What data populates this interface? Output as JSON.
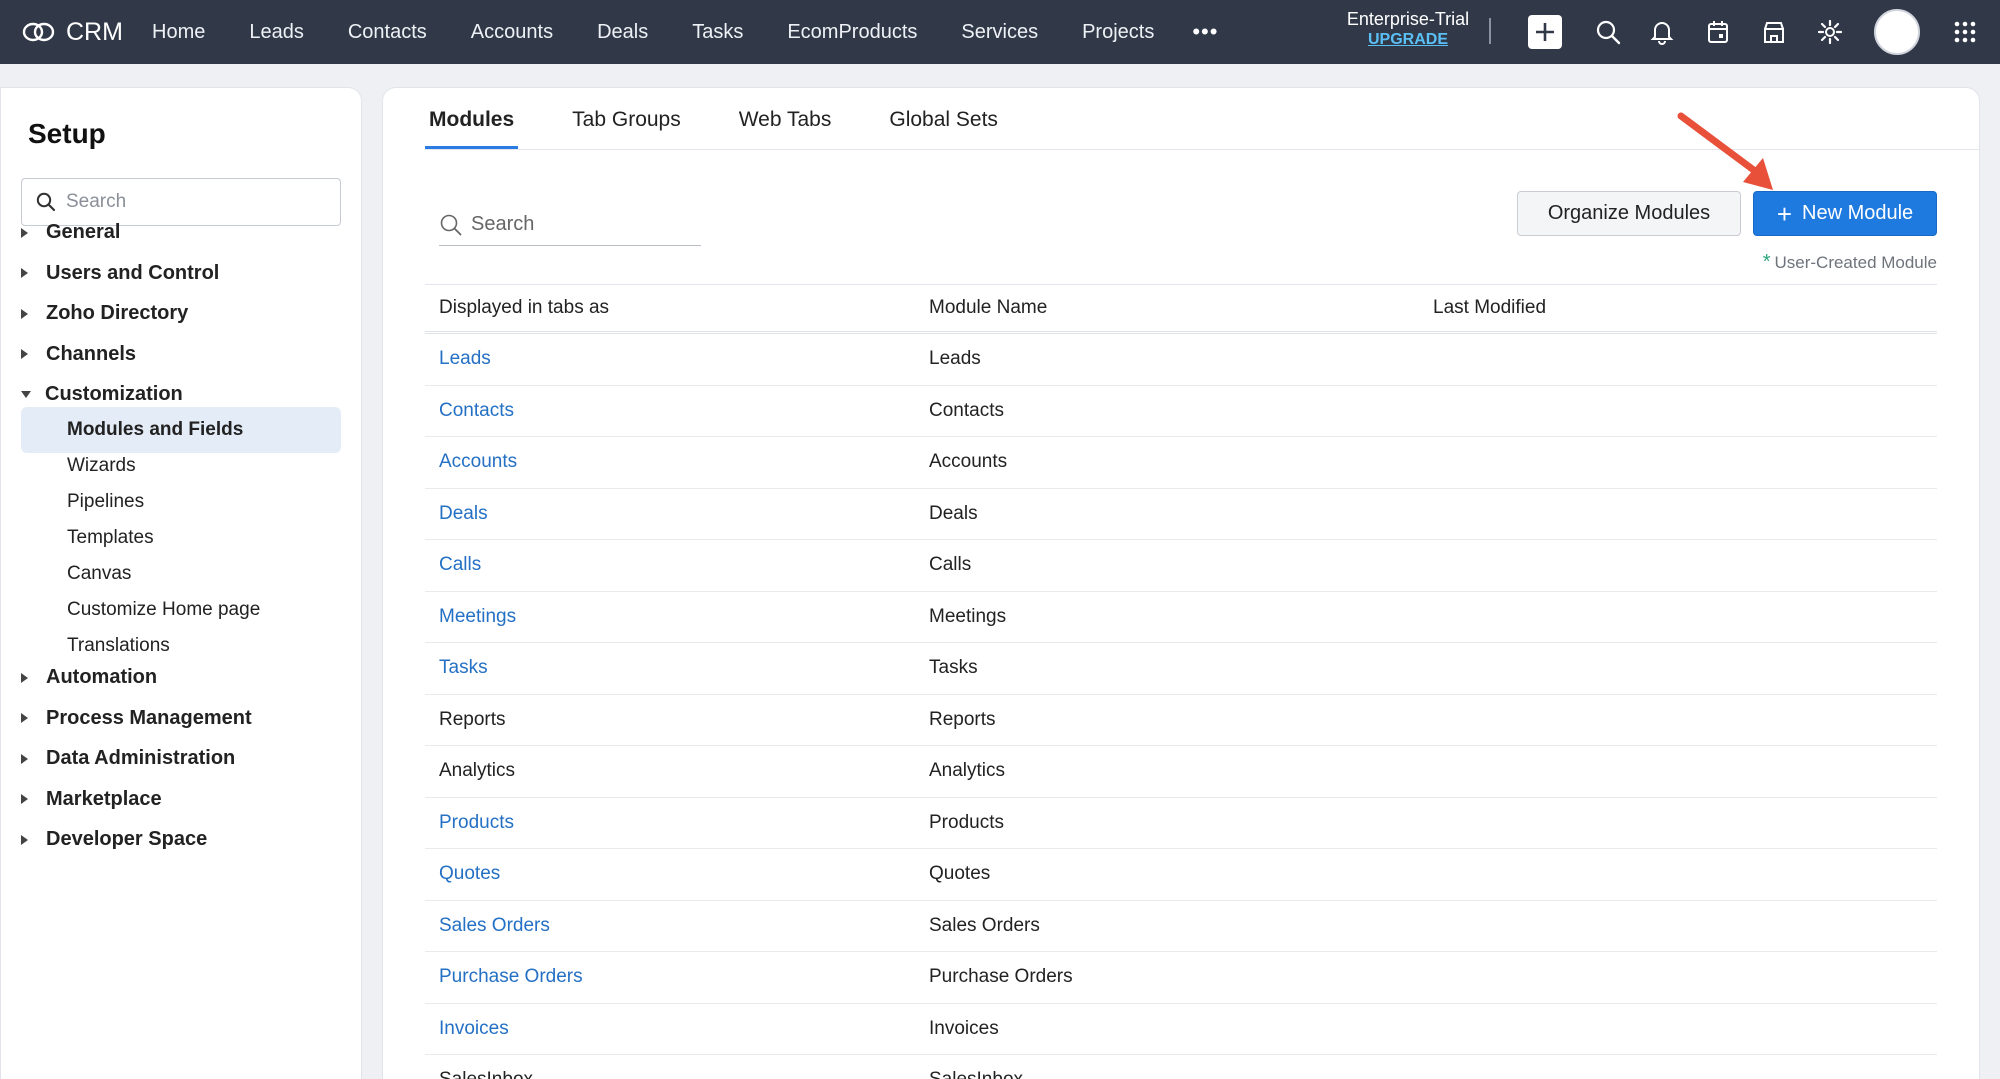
{
  "topbar": {
    "brand": "CRM",
    "nav": [
      "Home",
      "Leads",
      "Contacts",
      "Accounts",
      "Deals",
      "Tasks",
      "EcomProducts",
      "Services",
      "Projects"
    ],
    "more": "•••",
    "plan": "Enterprise-Trial",
    "upgrade": "UPGRADE"
  },
  "sidebar": {
    "title": "Setup",
    "search_placeholder": "Search",
    "groups_top": [
      "General",
      "Users and Control",
      "Zoho Directory",
      "Channels"
    ],
    "customization": {
      "label": "Customization",
      "items": [
        "Modules and Fields",
        "Wizards",
        "Pipelines",
        "Templates",
        "Canvas",
        "Customize Home page",
        "Translations"
      ],
      "active": "Modules and Fields"
    },
    "groups_bottom": [
      "Automation",
      "Process Management",
      "Data Administration",
      "Marketplace",
      "Developer Space"
    ]
  },
  "main": {
    "tabs": [
      "Modules",
      "Tab Groups",
      "Web Tabs",
      "Global Sets"
    ],
    "active_tab": "Modules",
    "search_placeholder": "Search",
    "organize_label": "Organize Modules",
    "new_module_label": "New Module",
    "legend": "User-Created Module",
    "columns": [
      "Displayed in tabs as",
      "Module Name",
      "Last Modified"
    ],
    "rows": [
      {
        "tab": "Leads",
        "name": "Leads",
        "link": true
      },
      {
        "tab": "Contacts",
        "name": "Contacts",
        "link": true
      },
      {
        "tab": "Accounts",
        "name": "Accounts",
        "link": true
      },
      {
        "tab": "Deals",
        "name": "Deals",
        "link": true
      },
      {
        "tab": "Calls",
        "name": "Calls",
        "link": true
      },
      {
        "tab": "Meetings",
        "name": "Meetings",
        "link": true
      },
      {
        "tab": "Tasks",
        "name": "Tasks",
        "link": true
      },
      {
        "tab": "Reports",
        "name": "Reports",
        "link": false
      },
      {
        "tab": "Analytics",
        "name": "Analytics",
        "link": false
      },
      {
        "tab": "Products",
        "name": "Products",
        "link": true
      },
      {
        "tab": "Quotes",
        "name": "Quotes",
        "link": true
      },
      {
        "tab": "Sales Orders",
        "name": "Sales Orders",
        "link": true
      },
      {
        "tab": "Purchase Orders",
        "name": "Purchase Orders",
        "link": true
      },
      {
        "tab": "Invoices",
        "name": "Invoices",
        "link": true
      },
      {
        "tab": "SalesInbox",
        "name": "SalesInbox",
        "link": false
      }
    ]
  },
  "colors": {
    "topbar": "#313949",
    "accent": "#1f7ae0",
    "link": "#2470c4",
    "annotation_arrow": "#e8503a"
  }
}
